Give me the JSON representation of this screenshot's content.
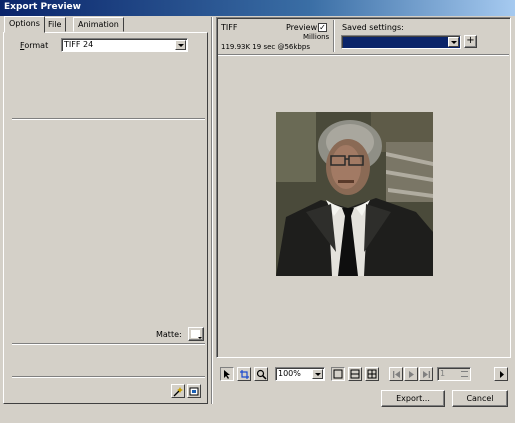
{
  "window": {
    "title": "Export Preview"
  },
  "tabs": [
    {
      "label": "Options"
    },
    {
      "label": "File"
    },
    {
      "label": "Animation"
    }
  ],
  "options": {
    "format_label": "Format",
    "format_value": "TIFF 24",
    "matte_label": "Matte:"
  },
  "preview": {
    "format": "TIFF",
    "preview_label": "Preview",
    "preview_checked": true,
    "colors": "Millions",
    "stats": "119.93K  19 sec @56kbps",
    "saved_settings_label": "Saved settings:",
    "saved_settings_value": ""
  },
  "toolbar": {
    "zoom_value": "100%",
    "frame_value": "1"
  },
  "buttons": {
    "export": "Export...",
    "cancel": "Cancel"
  },
  "colors": {
    "titlebar_start": "#0a246a",
    "titlebar_end": "#a6caf0",
    "saved_settings_bg": "#0a246a",
    "face": "#d4d0c8"
  },
  "icons": [
    "pointer-icon",
    "crop-icon",
    "zoom-icon",
    "single-view-icon",
    "two-view-icon",
    "four-view-icon",
    "first-frame-icon",
    "play-icon",
    "last-frame-icon",
    "next-icon",
    "magic-wand-icon",
    "matte-icon"
  ]
}
